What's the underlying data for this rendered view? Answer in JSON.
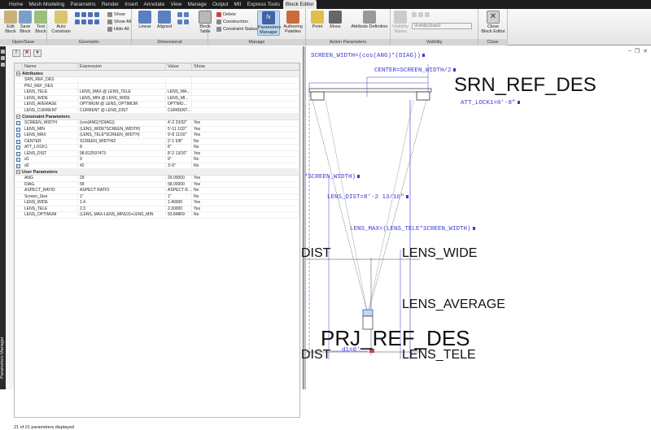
{
  "ribbon_tabs": [
    "Home",
    "Mesh Modeling",
    "Parametric",
    "Render",
    "Insert",
    "Annotate",
    "View",
    "Manage",
    "Output",
    "MII",
    "Express Tools",
    "Block Editor"
  ],
  "ribbon_panels": {
    "open_save": {
      "label": "Open/Save",
      "edit_block": "Edit\nBlock",
      "save_block": "Save\nBlock",
      "test_block": "Test\nBlock"
    },
    "geometric": {
      "label": "Geometric",
      "auto_constrain": "Auto\nConstrain",
      "show": "Show",
      "show_all": "Show All",
      "hide_all": "Hide All"
    },
    "dimensional": {
      "label": "Dimensional",
      "linear": "Linear",
      "aligned": "Aligned"
    },
    "manage": {
      "label": "Manage",
      "block_table": "Block\nTable",
      "delete": "Delete",
      "construction": "Construction",
      "constraint_status": "Constraint Status",
      "parameters_manager": "Parameters\nManager",
      "authoring_palettes": "Authoring\nPalettes"
    },
    "action_parameters": {
      "label": "Action Parameters",
      "point": "Point",
      "move": "Move",
      "attribute_definition": "Attribute Definition"
    },
    "visibility": {
      "label": "Visibility",
      "visibility_states": "Visibility\nStates",
      "dropdown": "VisibilityState0"
    },
    "close": {
      "label": "Close",
      "close_block_editor": "Close\nBlock Editor"
    }
  },
  "side_panel_title": "Parameters Manager",
  "parameters_manager": {
    "columns": [
      "Name",
      "Expression",
      "Value",
      "Show"
    ],
    "sections": [
      {
        "title": "Attributes",
        "rows": [
          {
            "name": "SRN_REF_DES",
            "expr": "",
            "value": "",
            "show": ""
          },
          {
            "name": "PRJ_REF_DES",
            "expr": "",
            "value": "",
            "show": ""
          },
          {
            "name": "LENS_TELE",
            "expr": "LENS_MAX @ LENS_TELE",
            "value": "LENS_MA...",
            "show": ""
          },
          {
            "name": "LENS_WIDE",
            "expr": "LENS_MIN @ LENS_WIDE",
            "value": "LENS_MI...",
            "show": ""
          },
          {
            "name": "LENS_AVERAGE",
            "expr": "OPTIMUM @ LENS_OPTIMUM",
            "value": "OPTIMU...",
            "show": ""
          },
          {
            "name": "LENS_CURRENT",
            "expr": "CURRENT @ LENS_DIST",
            "value": "CURRENT...",
            "show": ""
          }
        ]
      },
      {
        "title": "Constraint Parameters",
        "rows": [
          {
            "name": "SCREEN_WIDTH",
            "expr": "(cos(ANG)*(DIAG))",
            "value": "4'-2 23/32\"",
            "show": "Yes"
          },
          {
            "name": "LENS_MIN",
            "expr": "(LENS_WIDE*SCREEN_WIDTH)",
            "value": "5'-11 1/32\"",
            "show": "Yes"
          },
          {
            "name": "LENS_MAX",
            "expr": "(LENS_TELE*SCREEN_WIDTH)",
            "value": "9'-8 11/16\"",
            "show": "Yes"
          },
          {
            "name": "CENTER",
            "expr": "SCREEN_WIDTH/2",
            "value": "2'-1 5/8\"",
            "show": "No"
          },
          {
            "name": "ATT_LOCK1",
            "expr": "8",
            "value": "8\"",
            "show": "No"
          },
          {
            "name": "LENS_DIST",
            "expr": "98.812597473",
            "value": "8'-2 13/16\"",
            "show": "Yes"
          },
          {
            "name": "d1",
            "expr": "9",
            "value": "9\"",
            "show": "No"
          },
          {
            "name": "d2",
            "expr": "42",
            "value": "3'-6\"",
            "show": "No"
          }
        ]
      },
      {
        "title": "User Parameters",
        "rows": [
          {
            "name": "ANG",
            "expr": "29",
            "value": "29.00000",
            "show": "Yes"
          },
          {
            "name": "DIAG",
            "expr": "58",
            "value": "58.00000",
            "show": "Yes"
          },
          {
            "name": "ASPECT_RATIO",
            "expr": "ASPECT RATIO",
            "value": "ASPECT R...",
            "show": "No"
          },
          {
            "name": "Screen_Size",
            "expr": "1\"",
            "value": "1\"",
            "show": "No"
          },
          {
            "name": "LENS_WIDE",
            "expr": "1.4",
            "value": "1.40000",
            "show": "Yes"
          },
          {
            "name": "LENS_TELE",
            "expr": "2.3",
            "value": "2.30000",
            "show": "Yes"
          },
          {
            "name": "LENS_OPTIMUM",
            "expr": "(LENS_MAX-LENS_MIN)/2)+LENS_MIN",
            "value": "93.84869",
            "show": "No"
          }
        ]
      }
    ],
    "status": "21 of 21 parameters displayed"
  },
  "canvas": {
    "dim_screen_width": "SCREEN_WIDTH=(cos(ANG)*(DIAG))",
    "dim_center": "CENTER=SCREEN_WIDTH/2",
    "srn_ref_des": "SRN_REF_DES",
    "dim_att_lock1": "ATT_LOCK1=0'-8\"",
    "dim_screen_width_partial": "*SCREEN_WIDTH)",
    "dim_lens_dist": "LENS_DIST=8'-2 13/16\"",
    "dim_lens_max": "LENS_MAX=(LENS_TELE*SCREEN_WIDTH)",
    "dist_upper": "DIST",
    "lens_wide": "LENS_WIDE",
    "lens_average": "LENS_AVERAGE",
    "prj_ref_des": "PRJ_REF_DES",
    "dist_lower": "DIST",
    "dim_d1": "d1=0'",
    "lens_tele": "LENS_TELE"
  },
  "colors": {
    "dimension": "#3a3ad0",
    "selection": "#bcd9f2",
    "canvas_bg": "#ffffff"
  }
}
